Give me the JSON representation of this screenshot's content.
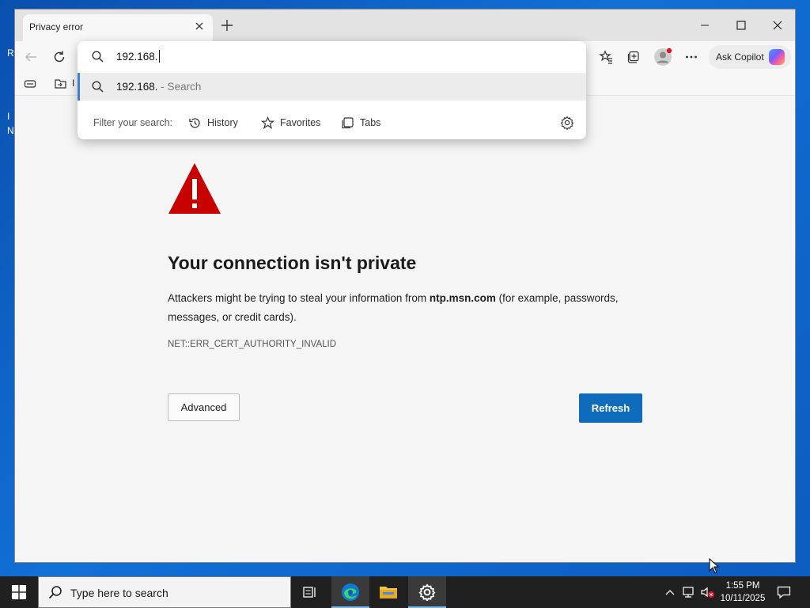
{
  "desktop": {
    "left_letters": [
      "R",
      "I",
      "N"
    ]
  },
  "browser": {
    "tab": {
      "title": "Privacy error",
      "close_icon": "close-icon"
    },
    "new_tab_icon": "plus-icon",
    "window_controls": [
      "minimize-icon",
      "maximize-icon",
      "close-icon"
    ],
    "toolbar": {
      "back_icon": "back-arrow-icon",
      "refresh_icon": "refresh-icon",
      "favorites_icon": "favorites-icon",
      "collections_icon": "collections-icon",
      "profile_icon": "profile-icon",
      "more_icon": "more-icon",
      "copilot_label": "Ask Copilot"
    },
    "favorites_bar": {
      "visible_fragment": "I"
    },
    "omnibox": {
      "value": "192.168.",
      "suggestion": {
        "text": "192.168.",
        "suffix": " - Search"
      },
      "filter": {
        "label": "Filter your search:",
        "options": [
          "History",
          "Favorites",
          "Tabs"
        ]
      }
    },
    "page": {
      "headline": "Your connection isn't private",
      "description_pre": "Attackers might be trying to steal your information from ",
      "host": "ntp.msn.com",
      "description_post": " (for example, passwords, messages, or credit cards).",
      "error_code": "NET::ERR_CERT_AUTHORITY_INVALID",
      "advanced_label": "Advanced",
      "refresh_label": "Refresh",
      "warning_color": "#c80000",
      "accent_color": "#0f6cbd"
    }
  },
  "taskbar": {
    "search_placeholder": "Type here to search",
    "apps": [
      "task-view-icon",
      "edge-icon",
      "file-explorer-icon",
      "settings-icon"
    ],
    "clock": {
      "time": "1:55 PM",
      "date": "10/11/2025"
    }
  }
}
